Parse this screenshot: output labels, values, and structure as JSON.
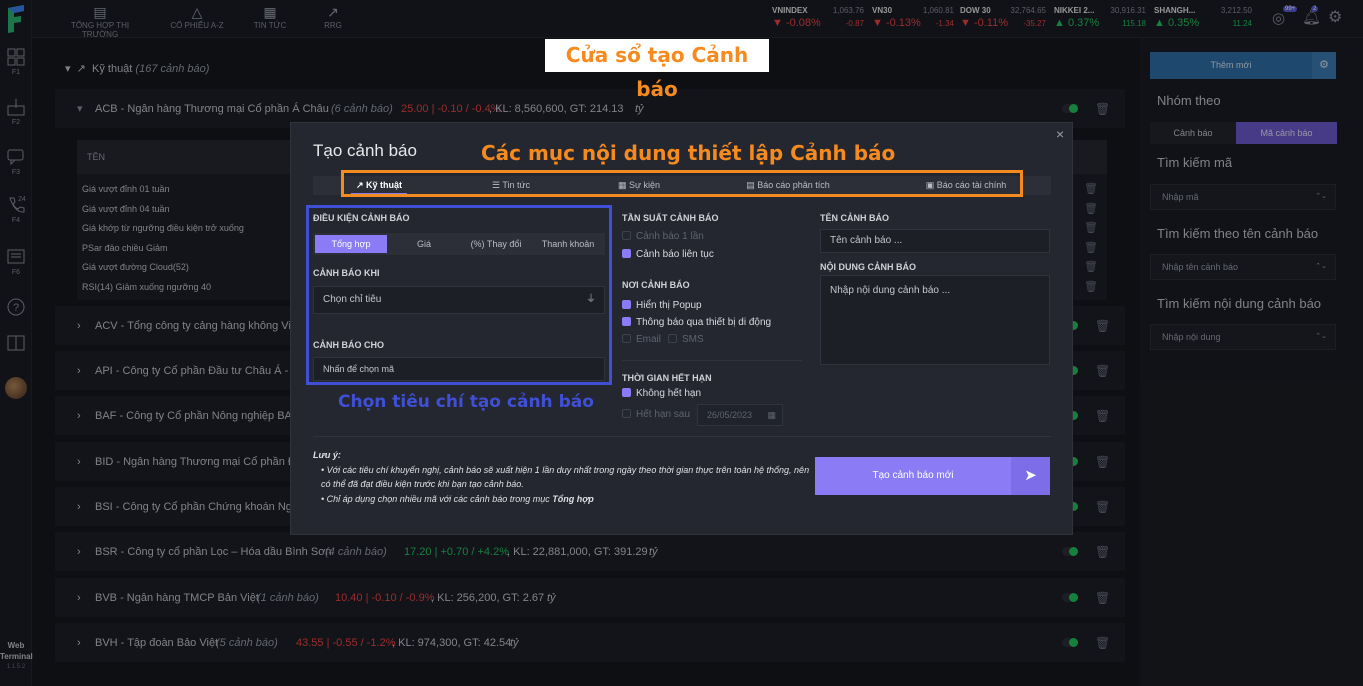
{
  "sidebar": {
    "items": [
      {
        "key": "F1"
      },
      {
        "key": "F2"
      },
      {
        "key": "F3"
      },
      {
        "key": "F4",
        "badge": "24"
      },
      {
        "key": "F6"
      }
    ],
    "footer": {
      "line1": "Web",
      "line2": "Terminal",
      "version": "1.1.5.2"
    }
  },
  "topnav": {
    "items": [
      {
        "label": "TỔNG HỢP THỊ TRƯỜNG",
        "icon": "document-icon"
      },
      {
        "label": "CỔ PHIẾU A-Z",
        "icon": "shapes-icon"
      },
      {
        "label": "TIN TỨC",
        "icon": "news-icon"
      },
      {
        "label": "RRG",
        "icon": "trend-icon"
      }
    ]
  },
  "indices": [
    {
      "name": "VNINDEX",
      "value": "1,063.76",
      "pct": "-0.08%",
      "chg": "-0.87",
      "dir": "dn"
    },
    {
      "name": "VN30",
      "value": "1,060.81",
      "pct": "-0.13%",
      "chg": "-1.34",
      "dir": "dn"
    },
    {
      "name": "DOW 30",
      "value": "32,764.65",
      "pct": "-0.11%",
      "chg": "-35.27",
      "dir": "dn"
    },
    {
      "name": "NIKKEI 2...",
      "value": "30,916.31",
      "pct": "0.37%",
      "chg": "115.18",
      "dir": "up"
    },
    {
      "name": "SHANGH...",
      "value": "3,212.50",
      "pct": "0.35%",
      "chg": "11.24",
      "dir": "up"
    }
  ],
  "header": {
    "notif_badge": "99+",
    "notif_badge2": "2"
  },
  "group": {
    "title": "Kỹ thuật",
    "count": "(167 cảnh báo)"
  },
  "acb": {
    "title": "ACB - Ngân hàng Thương mại Cổ phần Á Châu",
    "count": "(6 cảnh báo)",
    "price": "25.00 | -0.10 / -0.4%",
    "kl": ", KL: 8,560,600, GT: 214.13",
    "unit": "tỷ",
    "col": "TÊN",
    "alerts": [
      "Giá vượt đỉnh 01 tuần",
      "Giá vượt đỉnh 04 tuần",
      "Giá khớp từ ngưỡng điều kiện trở xuống",
      "PSar đảo chiều Giảm",
      "Giá vượt đường Cloud(52)",
      "RSI(14) Giảm xuống ngưỡng 40"
    ]
  },
  "stocks": [
    {
      "title": "ACV - Tổng công ty cảng hàng không Việ"
    },
    {
      "title": "API - Công ty Cổ phần Đầu tư Châu Á - T"
    },
    {
      "title": "BAF - Công ty Cổ phần Nông nghiệp BAF"
    },
    {
      "title": "BID - Ngân hàng Thương mại Cổ phần Đ"
    },
    {
      "title": "BSI - Công ty Cổ phần Chứng khoán Ngâ"
    },
    {
      "title": "BSR - Công ty cổ phần Lọc – Hóa dầu Bình Sơn",
      "count": "(4 cảnh báo)",
      "price": "17.20 | +0.70 / +4.2%",
      "kl": ", KL: 22,881,000, GT: 391.29",
      "unit": "tỷ",
      "dir": "up"
    },
    {
      "title": "BVB - Ngân hàng TMCP Bản Việt",
      "count": "(1 cảnh báo)",
      "price": "10.40 | -0.10 / -0.9%",
      "kl": ", KL: 256,200, GT: 2.67",
      "unit": "tỷ",
      "dir": "dn"
    },
    {
      "title": "BVH - Tập đoàn Bảo Việt",
      "count": "(5 cảnh báo)",
      "price": "43.55 | -0.55 / -1.2%",
      "kl": ", KL: 974,300, GT: 42.54",
      "unit": "tỷ",
      "dir": "dn"
    }
  ],
  "right": {
    "add_btn": "Thêm mới",
    "group_title": "Nhóm theo",
    "group_tabs": [
      "Cảnh báo",
      "Mã cảnh báo"
    ],
    "search_code": "Tìm kiếm mã",
    "search_code_ph": "Nhập mã",
    "search_name": "Tìm kiếm theo tên cảnh báo",
    "search_name_ph": "Nhập tên cảnh báo",
    "search_content": "Tìm kiếm nội dung cảnh báo",
    "search_content_ph": "Nhập nội dung"
  },
  "modal": {
    "title": "Tạo cảnh báo",
    "tabs": [
      "Kỹ thuật",
      "Tin tức",
      "Sự kiện",
      "Báo cáo phân tích",
      "Báo cáo tài chính"
    ],
    "cond_label": "ĐIỀU KIỆN CẢNH BÁO",
    "cond_tabs": [
      "Tổng hợp",
      "Giá",
      "(%) Thay đổi",
      "Thanh khoản"
    ],
    "when_label": "CẢNH BÁO KHI",
    "when_ph": "Chọn chỉ tiêu",
    "for_label": "CẢNH BÁO CHO",
    "for_ph": "Nhấn để chọn mã",
    "freq_label": "TẦN SUẤT CẢNH BÁO",
    "freq_once": "Cảnh báo 1 lần",
    "freq_cont": "Cảnh báo liên tục",
    "where_label": "NƠI CẢNH BÁO",
    "popup": "Hiển thị Popup",
    "mobile": "Thông báo qua thiết bị di động",
    "email": "Email",
    "sms": "SMS",
    "exp_label": "THỜI GIAN HẾT HẠN",
    "no_exp": "Không hết hạn",
    "exp_after": "Hết hạn sau",
    "exp_date": "26/05/2023",
    "name_label": "TÊN CẢNH BÁO",
    "name_ph": "Tên cảnh báo ...",
    "content_label": "NỘI DUNG CẢNH BÁO",
    "content_ph": "Nhập nội dung cảnh báo ...",
    "note_title": "Lưu ý:",
    "note1": "Với các tiêu chí khuyến nghị, cảnh báo sẽ xuất hiện 1 lần duy nhất trong ngày theo thời gian thực trên toàn hệ thống, nên có thể đã đạt điều kiện trước khi bạn tạo cảnh báo.",
    "note2a": "Chỉ áp dụng chọn nhiều mã với các cảnh báo trong mục",
    "note2b": "Tổng hợp",
    "submit": "Tạo cảnh báo mới"
  },
  "annotations": {
    "window": "Cửa sổ tạo Cảnh báo",
    "tabs": "Các mục nội dung thiết lập Cảnh báo",
    "criteria": "Chọn tiêu chí tạo cảnh báo"
  },
  "colors": {
    "accent": "#8b7cf6",
    "up": "#22c55e",
    "down": "#ef4444",
    "annot_orange": "#f58a1f",
    "annot_blue": "#3f4fd6"
  }
}
